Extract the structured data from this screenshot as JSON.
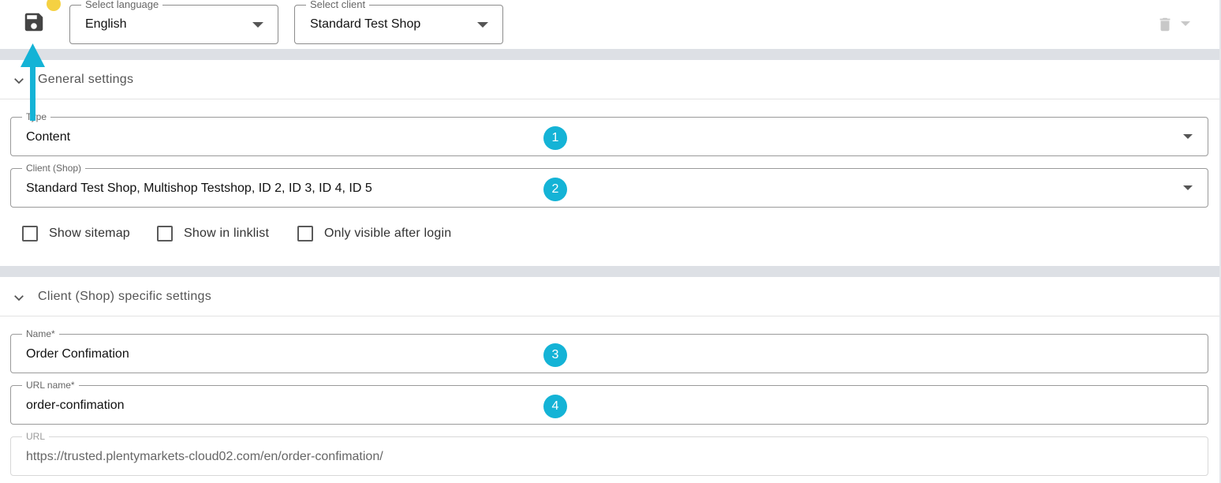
{
  "toolbar": {
    "save_icon": "save-icon",
    "language": {
      "label": "Select language",
      "value": "English"
    },
    "client": {
      "label": "Select client",
      "value": "Standard Test Shop"
    },
    "delete_icon": "trash-icon"
  },
  "general": {
    "title": "General settings",
    "type": {
      "label": "Type",
      "value": "Content"
    },
    "client_shop": {
      "label": "Client (Shop)",
      "value": "Standard Test Shop, Multishop Testshop, ID 2, ID 3, ID 4, ID 5"
    },
    "checkboxes": [
      {
        "label": "Show sitemap",
        "checked": false
      },
      {
        "label": "Show in linklist",
        "checked": false
      },
      {
        "label": "Only visible after login",
        "checked": false
      }
    ]
  },
  "specific": {
    "title": "Client (Shop) specific settings",
    "name": {
      "label": "Name*",
      "value": "Order Confimation"
    },
    "url_name": {
      "label": "URL name*",
      "value": "order-confimation"
    },
    "url": {
      "label": "URL",
      "value": "https://trusted.plentymarkets-cloud02.com/en/order-confimation/"
    }
  },
  "badges": [
    "1",
    "2",
    "3",
    "4"
  ],
  "colors": {
    "accent": "#14b3d6",
    "notification_dot": "#f5d142",
    "band": "#dde0e5"
  }
}
